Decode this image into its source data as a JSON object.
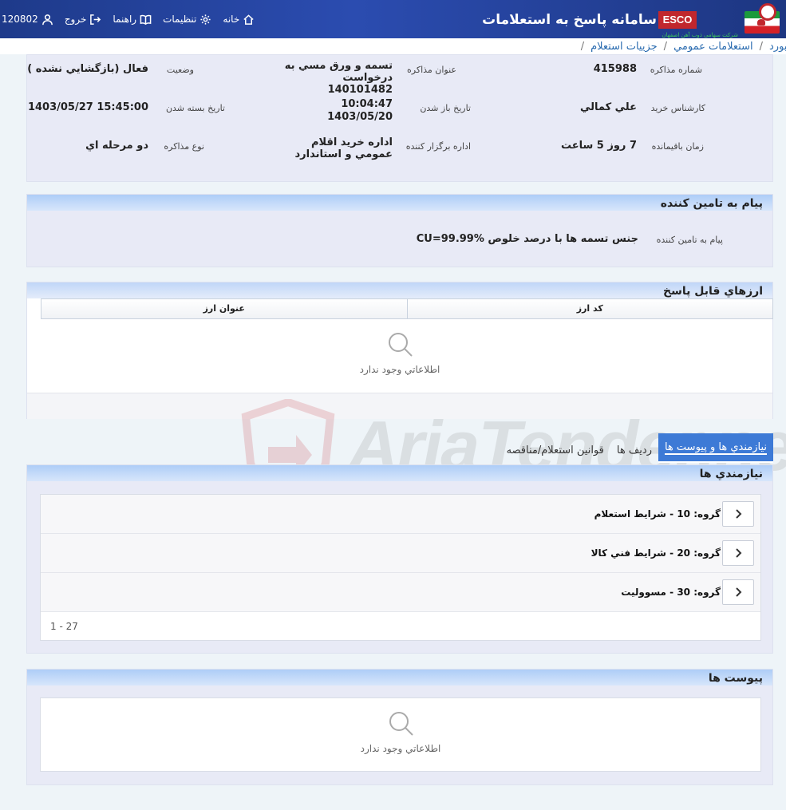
{
  "header": {
    "system_title": "سامانه پاسخ به استعلامات",
    "logo_text": "ESCO",
    "logo_subtext": "شرکت سهامی ذوب آهن اصفهان",
    "user_id": "120802",
    "nav": {
      "exit": "خروج",
      "help": "راهنما",
      "settings": "تنظيمات",
      "home": "خانه"
    }
  },
  "breadcrumb": {
    "items": [
      "داشبورد",
      "استعلامات عمومي",
      "جزييات استعلام"
    ]
  },
  "info": {
    "row1": {
      "num_label": "شماره مذاکره",
      "num_value": "415988",
      "title_label": "عنوان مذاکره",
      "title_value": "تسمه و ورق مسي به درخواست 140101482",
      "status_label": "وضعيت",
      "status_value": "فعال (بازگشايي نشده )"
    },
    "row2": {
      "buyer_label": "کارشناس خريد",
      "buyer_value": "علي کمالي",
      "open_label": "تاريخ باز شدن",
      "open_time": "10:04:47",
      "open_date": "1403/05/20",
      "close_label": "تاريخ بسته شدن",
      "close_value": "1403/05/27 15:45:00"
    },
    "row3": {
      "remain_label": "زمان باقيمانده",
      "remain_value": "7 روز 5 ساعت",
      "org_label": "اداره برگزار کننده",
      "org_value": "اداره خريد اقلام عمومي و استاندارد",
      "type_label": "نوع مذاکره",
      "type_value": "دو مرحله اي"
    }
  },
  "message": {
    "title": "پيام به تامين کننده",
    "label": "پيام به تامين کننده",
    "value": "جنس تسمه ها با درصد خلوص CU=99.99%"
  },
  "currency": {
    "title": "ارزهاي قابل پاسخ",
    "columns": [
      "کد ارز",
      "عنوان ارز"
    ],
    "empty_text": "اطلاعاتي وجود ندارد"
  },
  "tabs": [
    {
      "label": "نيازمندي ها و پيوست ها",
      "active": true
    },
    {
      "label": "رديف ها",
      "active": false
    },
    {
      "label": "قوانين استعلام/مناقصه",
      "active": false
    }
  ],
  "needs": {
    "title": "نيازمندي ها",
    "groups": [
      {
        "label": "گروه: 10 - شرايط استعلام"
      },
      {
        "label": "گروه: 20 - شرايط فني کالا"
      },
      {
        "label": "گروه: 30 - مسووليت"
      }
    ],
    "pager": "1 - 27"
  },
  "attachments": {
    "title": "پيوست ها",
    "empty_text": "اطلاعاتي وجود ندارد"
  },
  "watermark": {
    "text": "AriaTender.neT"
  },
  "colors": {
    "header_bg": "#1e3a8a",
    "link": "#2b6cb0",
    "tab_active": "#3d7ad6",
    "panel_bg": "#e8eaf6"
  }
}
